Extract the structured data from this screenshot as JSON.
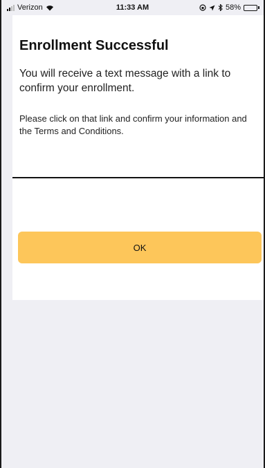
{
  "status_bar": {
    "carrier": "Verizon",
    "time": "11:33 AM",
    "battery": "58%",
    "battery_level": 0.58
  },
  "dialog": {
    "title": "Enrollment Successful",
    "message": "You will receive a text message with a link to confirm your enrollment.",
    "instructions": "Please click on that link and confirm your information and the Terms and Conditions.",
    "ok_label": "OK"
  },
  "colors": {
    "button_bg": "#fdc65a",
    "background": "#efeff4",
    "card": "#ffffff"
  },
  "icons": [
    "signal-icon",
    "wifi-icon",
    "location-lock-icon",
    "location-arrow-icon",
    "bluetooth-icon",
    "battery-icon"
  ]
}
